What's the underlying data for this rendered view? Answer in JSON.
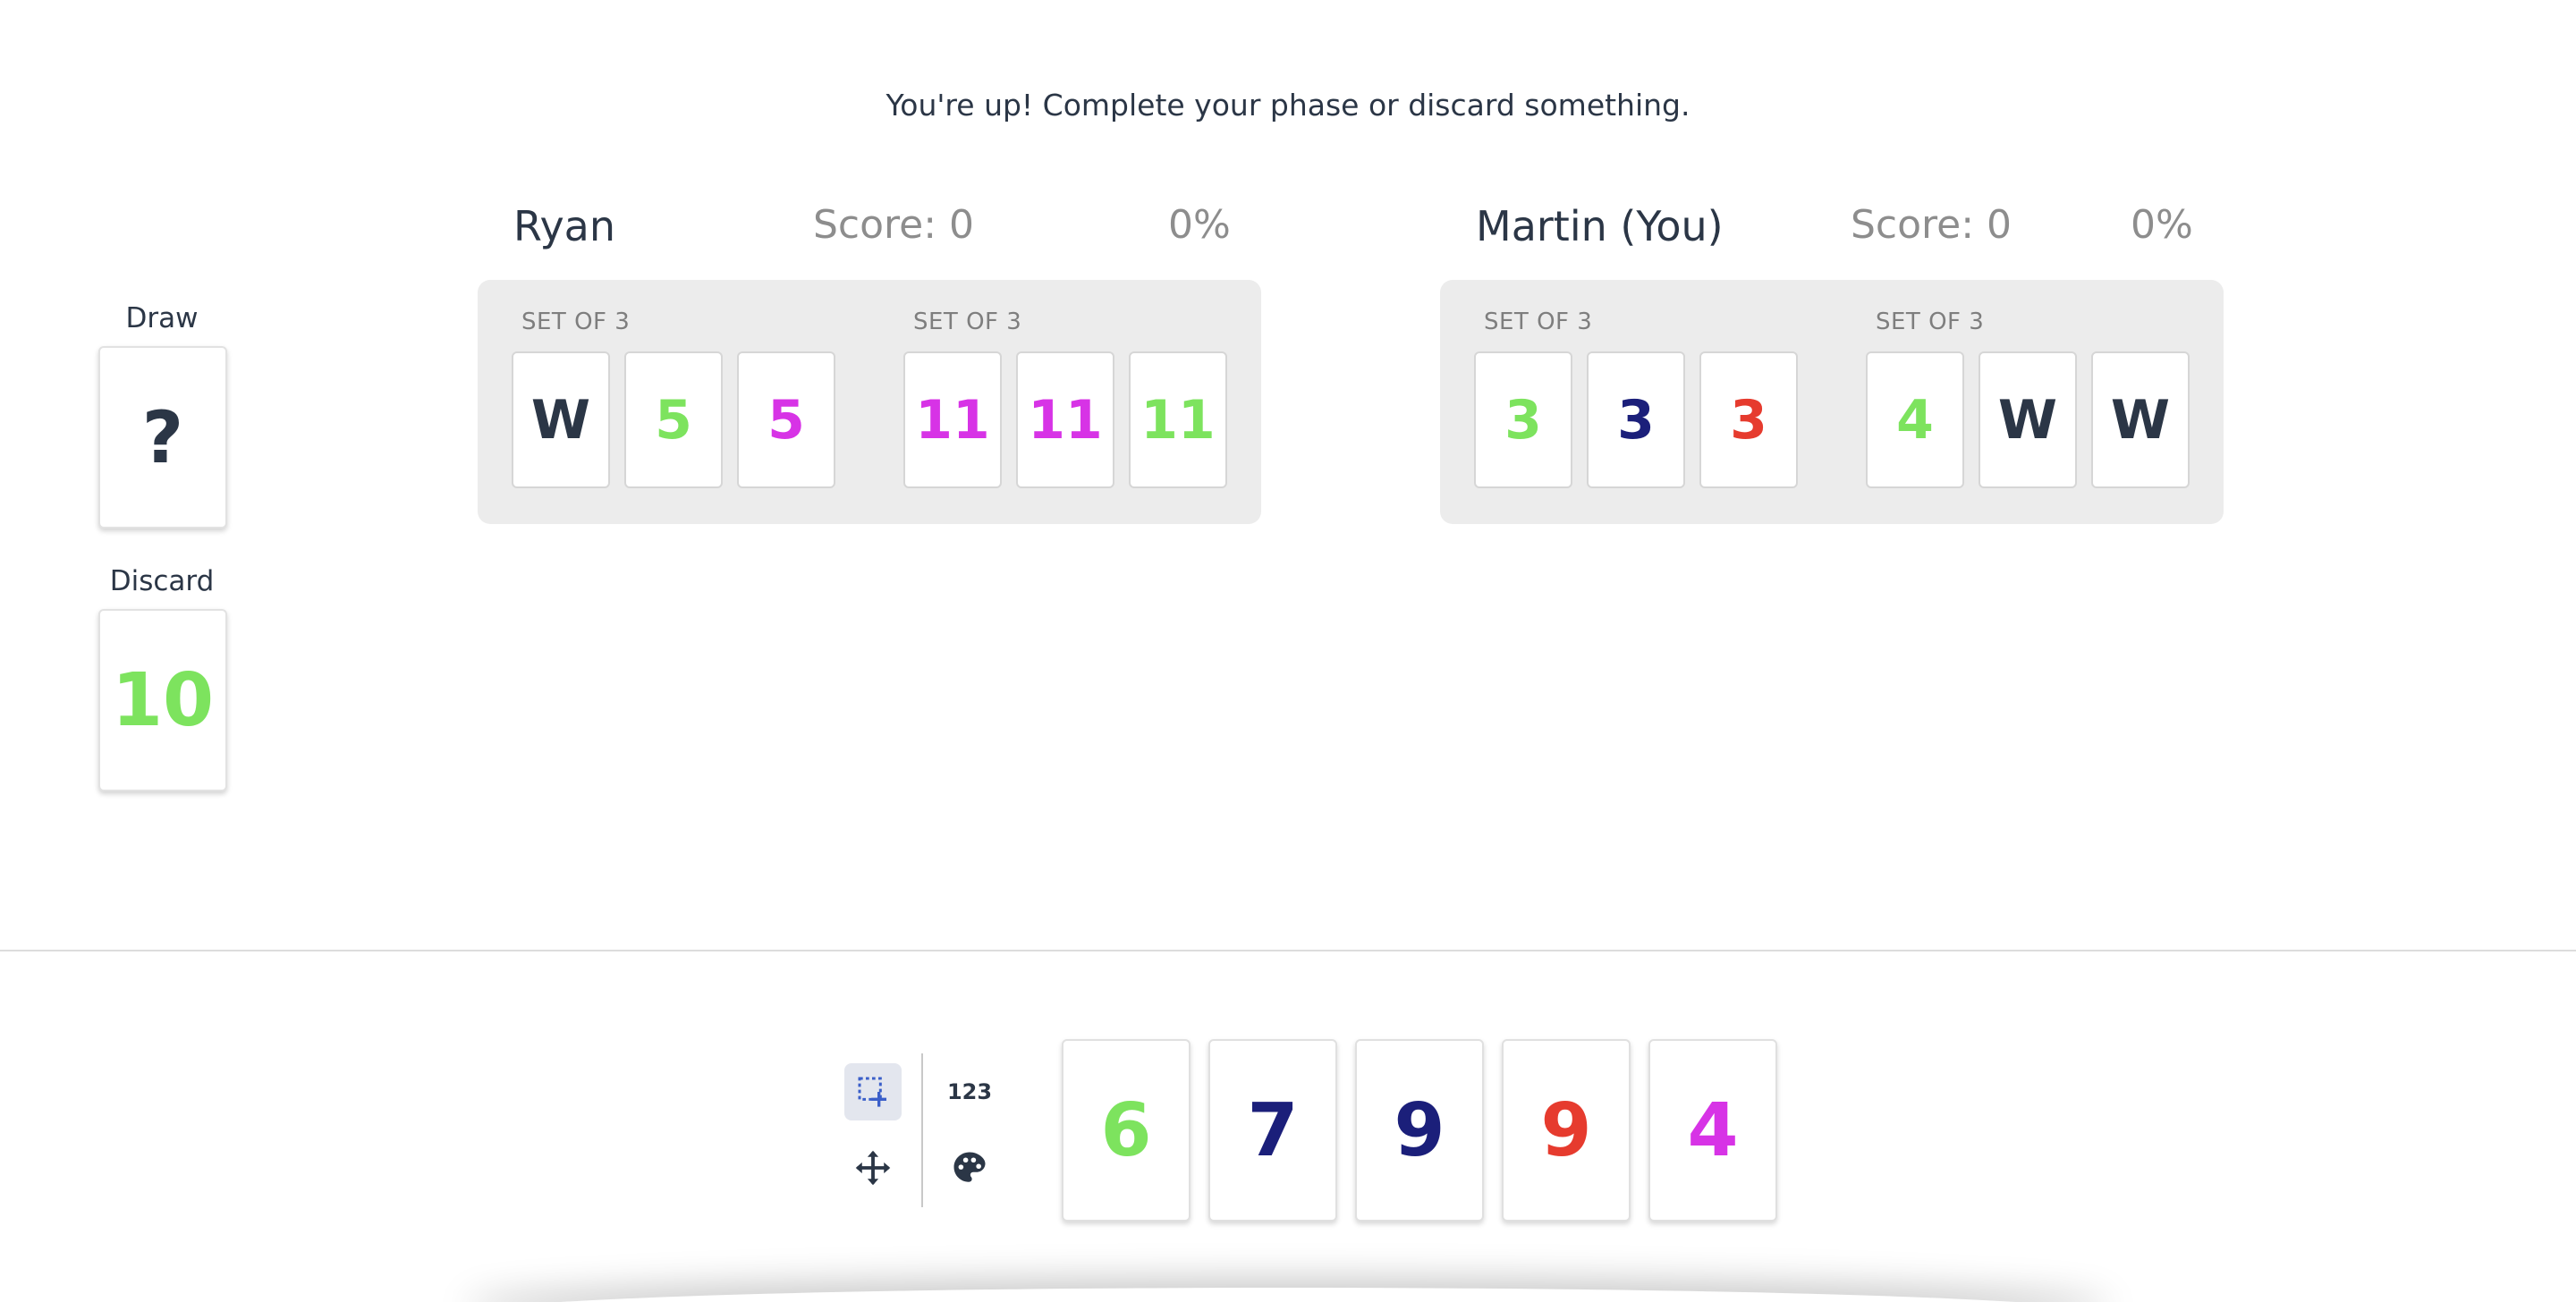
{
  "status_message": "You're up! Complete your phase or discard something.",
  "colors": {
    "green": "#7de35e",
    "magenta": "#d733e6",
    "navy": "#1b1f7a",
    "red": "#e63b2e",
    "wild": "#2b3646"
  },
  "draw_pile": {
    "label": "Draw",
    "card": "?"
  },
  "discard_pile": {
    "label": "Discard",
    "card": {
      "value": "10",
      "color": "green"
    }
  },
  "players": [
    {
      "name": "Ryan",
      "score": "Score: 0",
      "progress_label": "0%",
      "progress": 0,
      "groups": [
        {
          "label": "SET OF 3",
          "cards": [
            {
              "value": "W",
              "color": "wild"
            },
            {
              "value": "5",
              "color": "green"
            },
            {
              "value": "5",
              "color": "magenta"
            }
          ]
        },
        {
          "label": "SET OF 3",
          "cards": [
            {
              "value": "11",
              "color": "magenta"
            },
            {
              "value": "11",
              "color": "magenta"
            },
            {
              "value": "11",
              "color": "green"
            }
          ]
        }
      ]
    },
    {
      "name": "Martin (You)",
      "score": "Score: 0",
      "progress_label": "0%",
      "progress": 0,
      "groups": [
        {
          "label": "SET OF 3",
          "cards": [
            {
              "value": "3",
              "color": "green"
            },
            {
              "value": "3",
              "color": "navy"
            },
            {
              "value": "3",
              "color": "red"
            }
          ]
        },
        {
          "label": "SET OF 3",
          "cards": [
            {
              "value": "4",
              "color": "green"
            },
            {
              "value": "W",
              "color": "wild"
            },
            {
              "value": "W",
              "color": "wild"
            }
          ]
        }
      ]
    }
  ],
  "toolbar": {
    "select_icon": "select-add-icon",
    "move_icon": "move-arrows-icon",
    "sort_number_label": "123",
    "sort_color_icon": "palette-icon"
  },
  "hand": [
    {
      "value": "6",
      "color": "green"
    },
    {
      "value": "7",
      "color": "navy"
    },
    {
      "value": "9",
      "color": "navy"
    },
    {
      "value": "9",
      "color": "red"
    },
    {
      "value": "4",
      "color": "magenta"
    }
  ]
}
